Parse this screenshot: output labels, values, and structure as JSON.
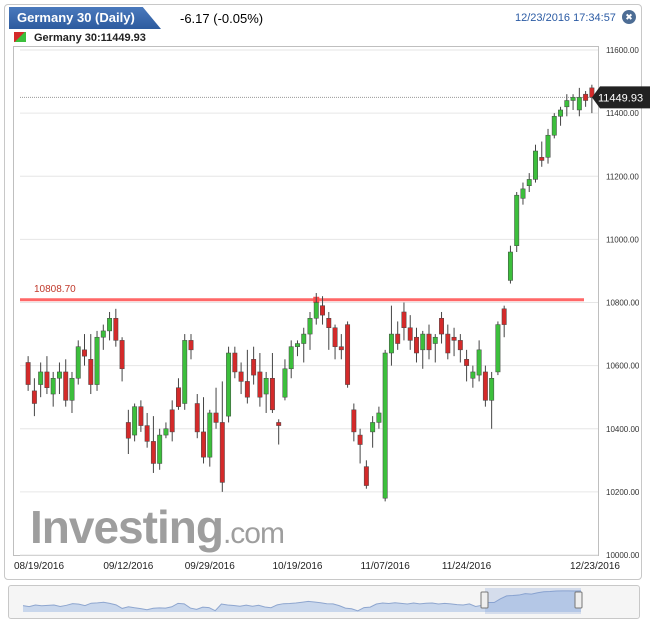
{
  "header": {
    "title": "Germany 30 (Daily)",
    "change": "-6.17 (-0.05%)",
    "datetime": "12/23/2016 17:34:57",
    "legend": "Germany 30:11449.93"
  },
  "watermark": {
    "brand": "Investing",
    "suffix": ".com"
  },
  "colors": {
    "up": "#3cbf3c",
    "down": "#d42a2a",
    "support_line": "#ff4d4d",
    "price_tag": "#222222",
    "title_bar": "#3a69af"
  },
  "chart_data": {
    "type": "candlestick",
    "symbol": "Germany 30",
    "ylim": [
      10000,
      11600
    ],
    "yticks": [
      "10000.00",
      "10200.00",
      "10400.00",
      "10600.00",
      "10800.00",
      "11000.00",
      "11200.00",
      "11400.00",
      "11600.00"
    ],
    "xticks": [
      "08/19/2016",
      "09/12/2016",
      "09/29/2016",
      "10/19/2016",
      "11/07/2016",
      "11/24/2016",
      "12/23/2016"
    ],
    "xtick_index": [
      0,
      16,
      29,
      43,
      57,
      70,
      92
    ],
    "current_price": 11449.93,
    "current_price_label": "11449.93",
    "support_level": 10808.7,
    "support_label": "10808.70",
    "candles": [
      [
        10610,
        10630,
        10520,
        10540
      ],
      [
        10520,
        10560,
        10440,
        10480
      ],
      [
        10540,
        10610,
        10500,
        10580
      ],
      [
        10580,
        10630,
        10510,
        10530
      ],
      [
        10510,
        10580,
        10470,
        10560
      ],
      [
        10560,
        10610,
        10510,
        10580
      ],
      [
        10580,
        10620,
        10470,
        10490
      ],
      [
        10490,
        10580,
        10450,
        10560
      ],
      [
        10560,
        10680,
        10540,
        10660
      ],
      [
        10650,
        10700,
        10600,
        10630
      ],
      [
        10620,
        10700,
        10510,
        10540
      ],
      [
        10540,
        10710,
        10520,
        10690
      ],
      [
        10690,
        10730,
        10650,
        10710
      ],
      [
        10710,
        10770,
        10680,
        10750
      ],
      [
        10750,
        10780,
        10660,
        10680
      ],
      [
        10680,
        10690,
        10550,
        10590
      ],
      [
        10420,
        10460,
        10320,
        10370
      ],
      [
        10380,
        10480,
        10360,
        10470
      ],
      [
        10470,
        10490,
        10390,
        10410
      ],
      [
        10410,
        10450,
        10340,
        10360
      ],
      [
        10360,
        10440,
        10260,
        10290
      ],
      [
        10290,
        10400,
        10270,
        10380
      ],
      [
        10380,
        10420,
        10370,
        10400
      ],
      [
        10460,
        10490,
        10360,
        10390
      ],
      [
        10530,
        10560,
        10460,
        10470
      ],
      [
        10480,
        10700,
        10460,
        10680
      ],
      [
        10680,
        10700,
        10620,
        10650
      ],
      [
        10480,
        10510,
        10370,
        10390
      ],
      [
        10390,
        10500,
        10290,
        10310
      ],
      [
        10310,
        10460,
        10280,
        10450
      ],
      [
        10450,
        10530,
        10400,
        10420
      ],
      [
        10420,
        10550,
        10200,
        10230
      ],
      [
        10440,
        10660,
        10420,
        10640
      ],
      [
        10640,
        10660,
        10560,
        10580
      ],
      [
        10580,
        10610,
        10510,
        10550
      ],
      [
        10550,
        10650,
        10480,
        10500
      ],
      [
        10620,
        10660,
        10540,
        10570
      ],
      [
        10580,
        10640,
        10470,
        10500
      ],
      [
        10510,
        10580,
        10450,
        10560
      ],
      [
        10560,
        10640,
        10450,
        10460
      ],
      [
        10420,
        10430,
        10350,
        10410
      ],
      [
        10500,
        10620,
        10490,
        10590
      ],
      [
        10590,
        10680,
        10560,
        10660
      ],
      [
        10660,
        10680,
        10630,
        10670
      ],
      [
        10670,
        10720,
        10610,
        10700
      ],
      [
        10700,
        10770,
        10650,
        10750
      ],
      [
        10750,
        10830,
        10730,
        10800
      ],
      [
        10790,
        10820,
        10730,
        10760
      ],
      [
        10750,
        10770,
        10650,
        10720
      ],
      [
        10720,
        10730,
        10620,
        10660
      ],
      [
        10660,
        10700,
        10620,
        10650
      ],
      [
        10730,
        10740,
        10530,
        10540
      ],
      [
        10460,
        10480,
        10360,
        10390
      ],
      [
        10380,
        10400,
        10290,
        10350
      ],
      [
        10280,
        10300,
        10210,
        10220
      ],
      [
        10390,
        10440,
        10340,
        10420
      ],
      [
        10420,
        10470,
        10400,
        10450
      ],
      [
        10180,
        10650,
        10170,
        10640
      ],
      [
        10640,
        10790,
        10600,
        10700
      ],
      [
        10700,
        10740,
        10650,
        10670
      ],
      [
        10770,
        10800,
        10680,
        10720
      ],
      [
        10720,
        10760,
        10650,
        10680
      ],
      [
        10690,
        10720,
        10610,
        10640
      ],
      [
        10650,
        10710,
        10590,
        10700
      ],
      [
        10700,
        10730,
        10620,
        10650
      ],
      [
        10670,
        10700,
        10610,
        10690
      ],
      [
        10750,
        10770,
        10670,
        10700
      ],
      [
        10700,
        10730,
        10620,
        10640
      ],
      [
        10690,
        10720,
        10630,
        10680
      ],
      [
        10680,
        10700,
        10610,
        10650
      ],
      [
        10620,
        10650,
        10550,
        10600
      ],
      [
        10560,
        10600,
        10530,
        10580
      ],
      [
        10570,
        10680,
        10550,
        10650
      ],
      [
        10580,
        10600,
        10470,
        10490
      ],
      [
        10490,
        10580,
        10400,
        10560
      ],
      [
        10580,
        10740,
        10570,
        10730
      ],
      [
        10780,
        10790,
        10690,
        10730
      ],
      [
        10870,
        10980,
        10860,
        10960
      ],
      [
        10980,
        11150,
        10960,
        11140
      ],
      [
        11130,
        11180,
        11110,
        11160
      ],
      [
        11170,
        11210,
        11150,
        11190
      ],
      [
        11190,
        11300,
        11180,
        11280
      ],
      [
        11260,
        11310,
        11230,
        11250
      ],
      [
        11260,
        11350,
        11240,
        11330
      ],
      [
        11330,
        11400,
        11320,
        11390
      ],
      [
        11390,
        11420,
        11360,
        11410
      ],
      [
        11420,
        11460,
        11390,
        11440
      ],
      [
        11440,
        11460,
        11410,
        11450
      ],
      [
        11410,
        11480,
        11390,
        11450
      ],
      [
        11460,
        11470,
        11420,
        11440
      ],
      [
        11480,
        11490,
        11400,
        11450
      ]
    ]
  }
}
